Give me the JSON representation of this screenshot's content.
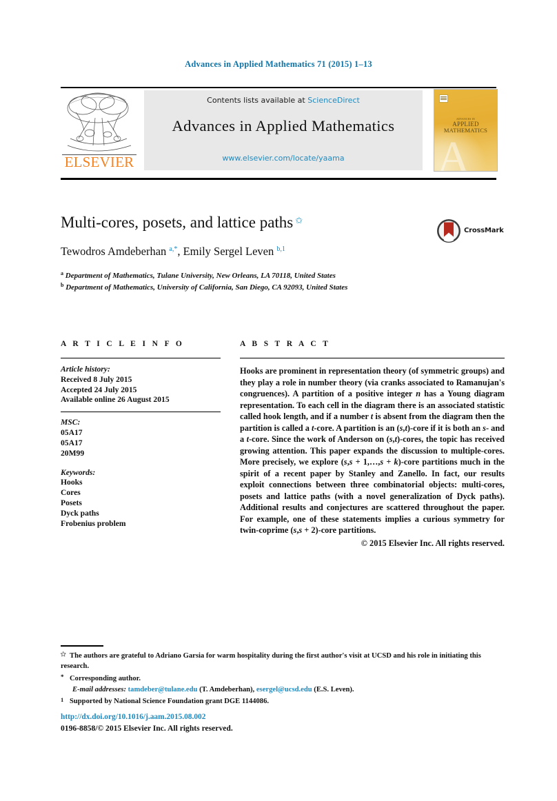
{
  "running_head": "Advances in Applied Mathematics 71 (2015) 1–13",
  "masthead": {
    "contents_prefix": "Contents lists available at ",
    "sciencedirect": "ScienceDirect",
    "journal_name": "Advances in Applied Mathematics",
    "journal_url": "www.elsevier.com/locate/yaama",
    "publisher": "ELSEVIER",
    "cover": {
      "line1": "ADVANCES IN",
      "line2": "APPLIED",
      "line3": "MATHEMATICS",
      "watermark": "A"
    },
    "link_color": "#1f8ac0",
    "publisher_color": "#f4821f",
    "band_color": "#e8e8e8"
  },
  "article": {
    "title": "Multi-cores, posets, and lattice paths",
    "title_footnote_mark": "✩",
    "authors_html": "Tewodros Amdeberhan <sup>a,*</sup>, Emily Sergel Leven <sup>b,1</sup>",
    "affiliations": [
      {
        "mark": "a",
        "text": "Department of Mathematics, Tulane University, New Orleans, LA 70118, United States"
      },
      {
        "mark": "b",
        "text": "Department of Mathematics, University of California, San Diego, CA 92093, United States"
      }
    ],
    "crossmark_label": "CrossMark"
  },
  "info": {
    "heading": "A R T I C L E   I N F O",
    "history_label": "Article history:",
    "history": [
      "Received 8 July 2015",
      "Accepted 24 July 2015",
      "Available online 26 August 2015"
    ],
    "msc_label": "MSC:",
    "msc": [
      "05A17",
      "05A17",
      "20M99"
    ],
    "keywords_label": "Keywords:",
    "keywords": [
      "Hooks",
      "Cores",
      "Posets",
      "Dyck paths",
      "Frobenius problem"
    ]
  },
  "abstract": {
    "heading": "A B S T R A C T",
    "body_html": "Hooks are prominent in representation theory (of symmetric groups) and they play a role in number theory (via cranks associated to Ramanujan's congruences). A partition of a positive integer <i>n</i> has a Young diagram representation. To each cell in the diagram there is an associated statistic called hook length, and if a number <i>t</i> is absent from the diagram then the partition is called a <i>t</i>-core. A partition is an (<i>s</i>,<i>t</i>)-core if it is both an <i>s</i>- and a <i>t</i>-core. Since the work of Anderson on (<i>s</i>,<i>t</i>)-cores, the topic has received growing attention. This paper expands the discussion to multiple-cores. More precisely, we explore (<i>s</i>,<i>s</i> + 1,…,<i>s</i> + <i>k</i>)-core partitions much in the spirit of a recent paper by Stanley and Zanello. In fact, our results exploit connections between three combinatorial objects: multi-cores, posets and lattice paths (with a novel generalization of Dyck paths). Additional results and conjectures are scattered throughout the paper. For example, one of these statements implies a curious symmetry for twin-coprime (<i>s</i>,<i>s</i> + 2)-core partitions.",
    "copyright": "© 2015 Elsevier Inc. All rights reserved."
  },
  "footnotes": [
    {
      "mark": "✩",
      "html": "The authors are grateful to Adriano Garsia for warm hospitality during the first author's visit at UCSD and his role in initiating this research."
    },
    {
      "mark": "*",
      "html": "Corresponding author."
    },
    {
      "mark": "",
      "html": "<span class=\"em\">E-mail addresses:</span> <span class=\"link\">tamdeber@tulane.edu</span> (T. Amdeberhan), <span class=\"link\">esergel@ucsd.edu</span> (E.S. Leven)."
    },
    {
      "mark": "1",
      "html": "Supported by National Science Foundation grant DGE 1144086."
    }
  ],
  "bottom": {
    "doi": "http://dx.doi.org/10.1016/j.aam.2015.08.002",
    "issn_line": "0196-8858/© 2015 Elsevier Inc. All rights reserved."
  }
}
